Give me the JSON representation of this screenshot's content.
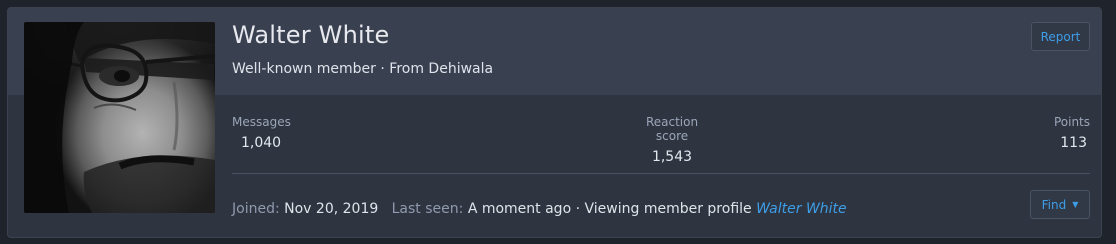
{
  "profile": {
    "name": "Walter White",
    "title": "Well-known member",
    "separator": " · ",
    "from_label": "From Dehiwala",
    "report_label": "Report"
  },
  "stats": [
    {
      "label": "Messages",
      "value": "1,040"
    },
    {
      "label": "Reaction score",
      "value": "1,543"
    },
    {
      "label": "Points",
      "value": "113"
    }
  ],
  "footer": {
    "joined_label": "Joined:",
    "joined_value": "Nov 20, 2019",
    "last_seen_label": "Last seen:",
    "last_seen_value": "A moment ago",
    "separator": " · ",
    "activity_text": "Viewing member profile",
    "activity_link": "Walter White",
    "find_label": "Find"
  },
  "icons": {
    "find_caret": "chevron-down-icon"
  },
  "colors": {
    "page_bg": "#1f232b",
    "card_bg": "#2f3540",
    "header_bg": "#394050",
    "accent": "#3d9ee8",
    "text": "#e3e7ee",
    "muted": "#9aa5b8"
  }
}
